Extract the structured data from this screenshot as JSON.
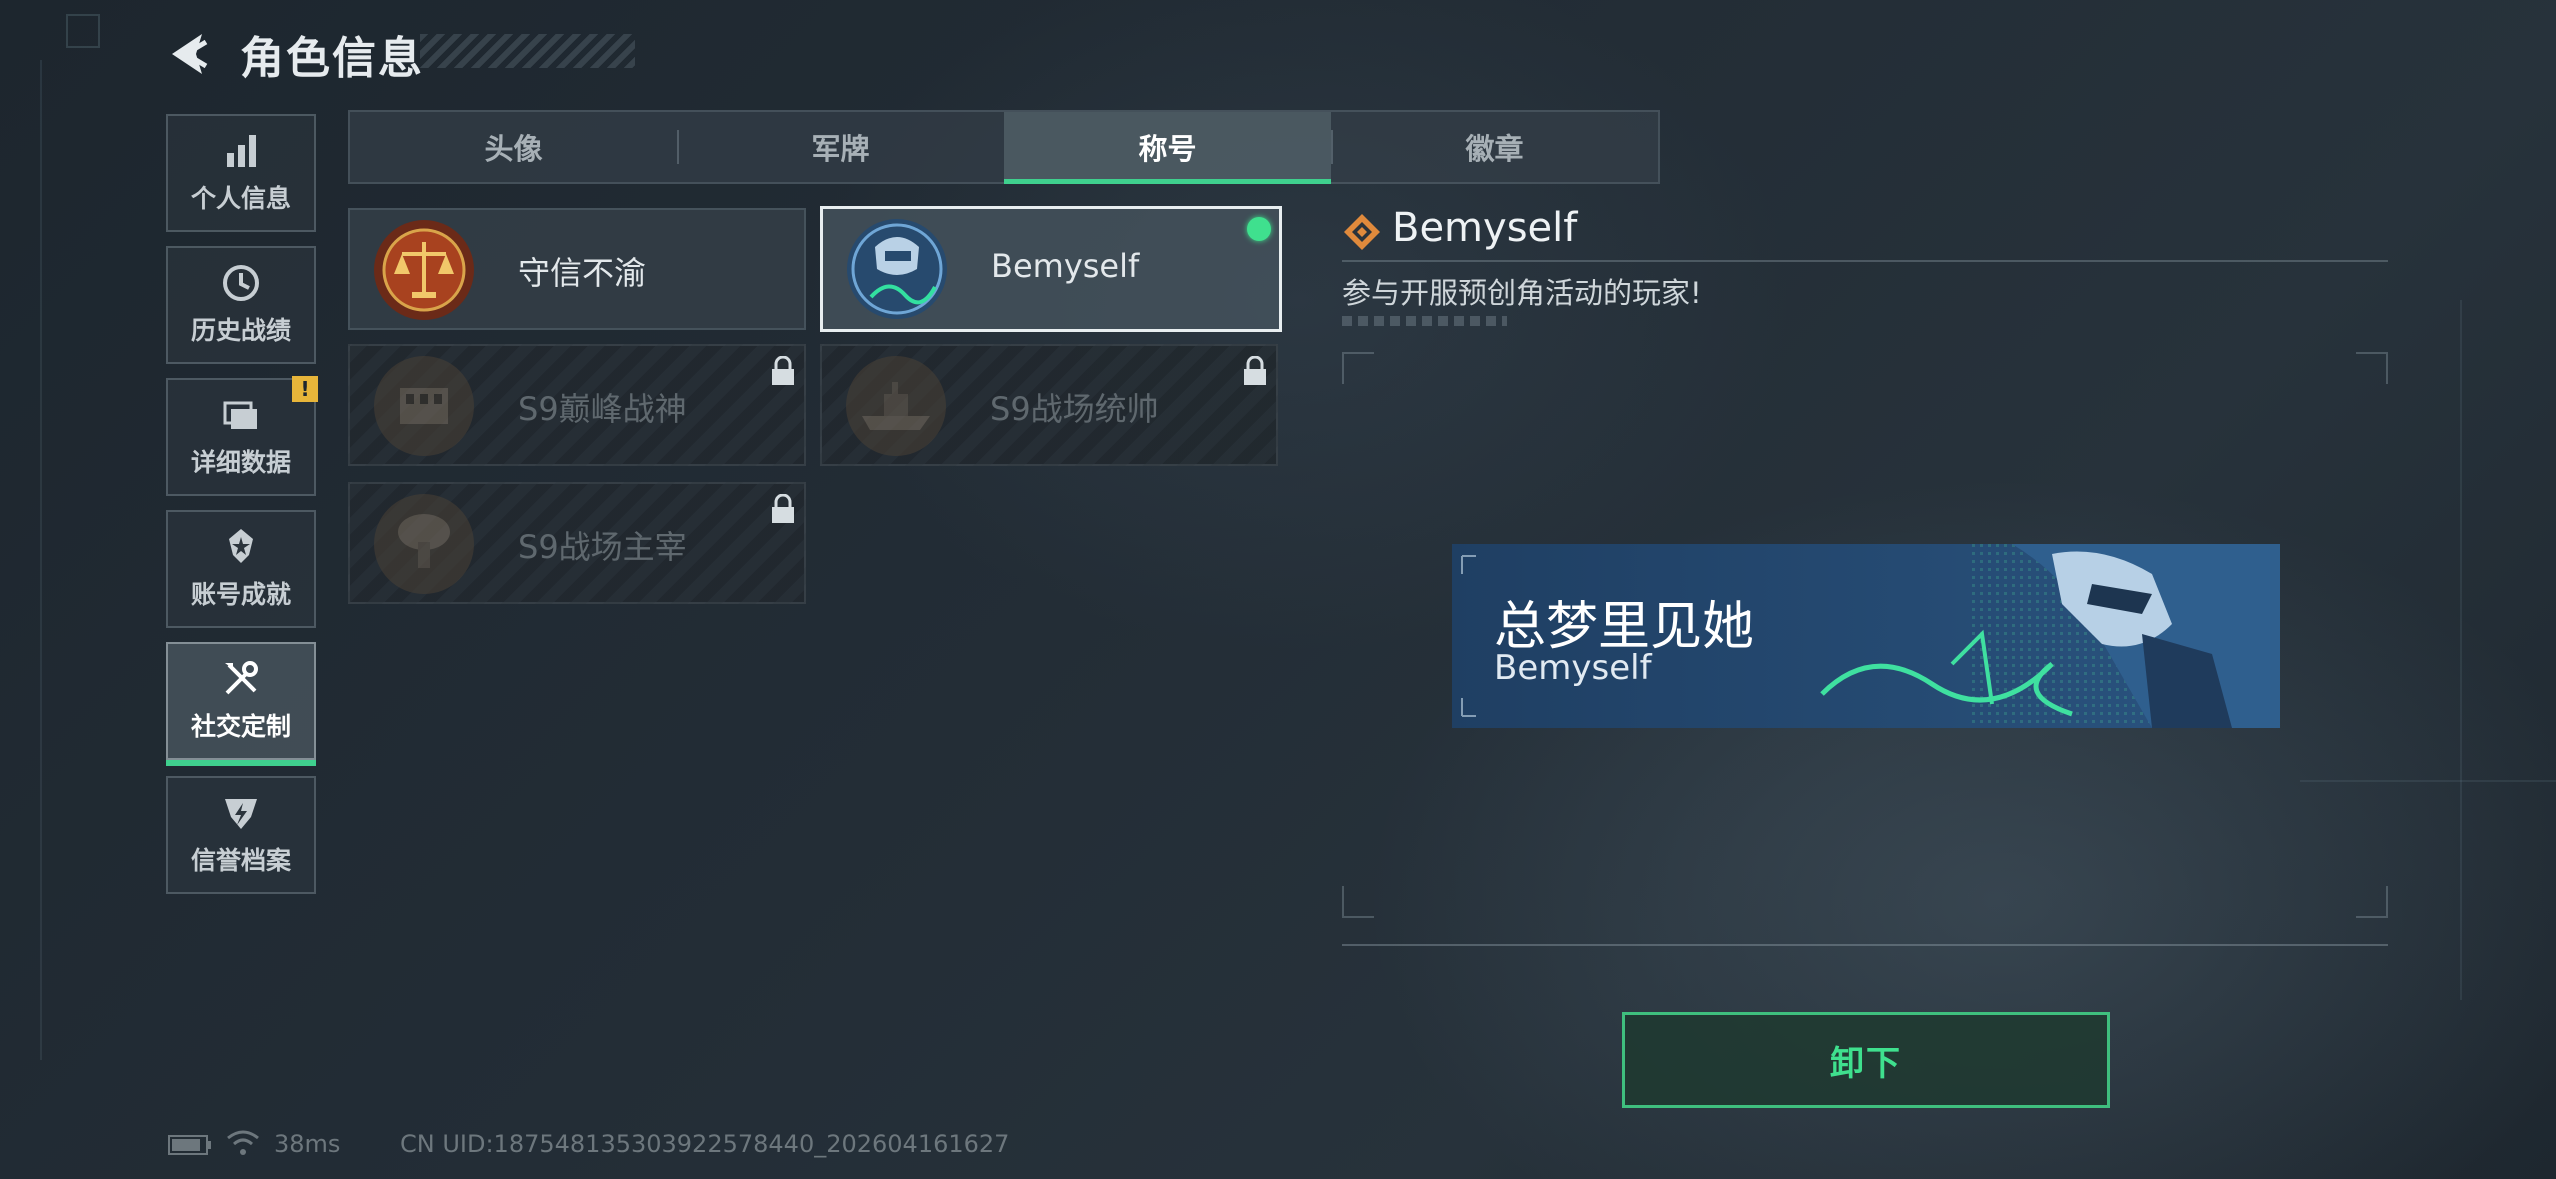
{
  "header": {
    "title": "角色信息"
  },
  "sidebar": {
    "items": [
      {
        "label": "个人信息",
        "icon": "bar-chart-icon",
        "active": false
      },
      {
        "label": "历史战绩",
        "icon": "history-clock-icon",
        "active": false
      },
      {
        "label": "详细数据",
        "icon": "folder-icon",
        "active": false,
        "badge": "!"
      },
      {
        "label": "账号成就",
        "icon": "achievement-medal-icon",
        "active": false
      },
      {
        "label": "社交定制",
        "icon": "wrench-screwdriver-icon",
        "active": true
      },
      {
        "label": "信誉档案",
        "icon": "reputation-shield-icon",
        "active": false
      }
    ]
  },
  "tabs": [
    {
      "label": "头像",
      "active": false
    },
    {
      "label": "军牌",
      "active": false
    },
    {
      "label": "称号",
      "active": true
    },
    {
      "label": "徽章",
      "active": false
    }
  ],
  "titles": [
    {
      "name": "守信不渝",
      "locked": false,
      "selected": false,
      "equipped": false,
      "icon": "scales-emblem-icon"
    },
    {
      "name": "Bemyself",
      "locked": false,
      "selected": true,
      "equipped": true,
      "icon": "soldier-signature-emblem-icon"
    },
    {
      "name": "S9巅峰战神",
      "locked": true,
      "selected": false,
      "equipped": false,
      "icon": "building-emblem-icon"
    },
    {
      "name": "S9战场统帅",
      "locked": true,
      "selected": false,
      "equipped": false,
      "icon": "warship-emblem-icon"
    },
    {
      "name": "S9战场主宰",
      "locked": true,
      "selected": false,
      "equipped": false,
      "icon": "explosion-emblem-icon"
    }
  ],
  "detail": {
    "name": "Bemyself",
    "description": "参与开服预创角活动的玩家!",
    "preview": {
      "title": "总梦里见她",
      "subtitle": "Bemyself"
    },
    "action_label": "卸下"
  },
  "status_bar": {
    "ping": "38ms",
    "uid": "CN UID:18754813530392257844​0_202604161627"
  },
  "colors": {
    "accent_green": "#3fd08e",
    "background": "#1f2830",
    "warning": "#e7b53a",
    "banner_blue": "#254a72"
  }
}
